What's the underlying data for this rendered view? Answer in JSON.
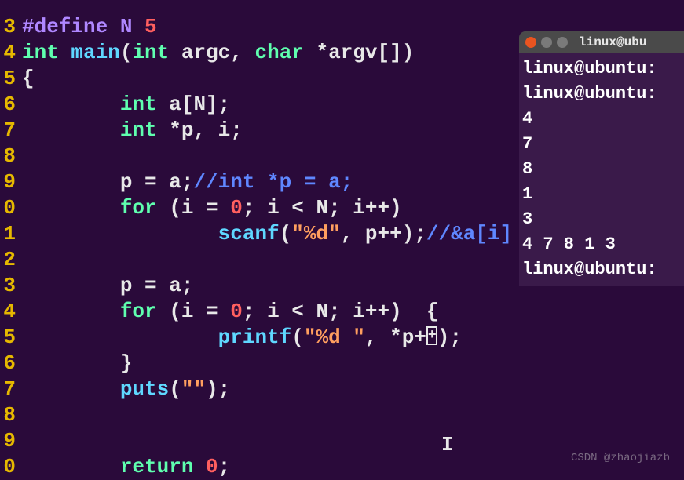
{
  "editor": {
    "lines": [
      {
        "no": "3",
        "segments": [
          {
            "cls": "pre",
            "t": "#define N "
          },
          {
            "cls": "num",
            "t": "5"
          }
        ]
      },
      {
        "no": "4",
        "segments": [
          {
            "cls": "kw",
            "t": "int "
          },
          {
            "cls": "func",
            "t": "main"
          },
          {
            "cls": "op",
            "t": "("
          },
          {
            "cls": "kw",
            "t": "int "
          },
          {
            "cls": "id",
            "t": "argc, "
          },
          {
            "cls": "kw",
            "t": "char "
          },
          {
            "cls": "op",
            "t": "*"
          },
          {
            "cls": "id",
            "t": "argv[])"
          }
        ]
      },
      {
        "no": "5",
        "segments": [
          {
            "cls": "op",
            "t": "{"
          }
        ]
      },
      {
        "no": "6",
        "segments": [
          {
            "cls": "id",
            "t": "        "
          },
          {
            "cls": "kw",
            "t": "int "
          },
          {
            "cls": "id",
            "t": "a[N];"
          }
        ]
      },
      {
        "no": "7",
        "segments": [
          {
            "cls": "id",
            "t": "        "
          },
          {
            "cls": "kw",
            "t": "int "
          },
          {
            "cls": "op",
            "t": "*"
          },
          {
            "cls": "id",
            "t": "p, i;"
          }
        ]
      },
      {
        "no": "8",
        "segments": []
      },
      {
        "no": "9",
        "segments": [
          {
            "cls": "id",
            "t": "        p = a;"
          },
          {
            "cls": "cm",
            "t": "//int *p = a;"
          }
        ]
      },
      {
        "no": "0",
        "segments": [
          {
            "cls": "id",
            "t": "        "
          },
          {
            "cls": "kw",
            "t": "for "
          },
          {
            "cls": "op",
            "t": "(i = "
          },
          {
            "cls": "num",
            "t": "0"
          },
          {
            "cls": "op",
            "t": "; i < N; i++)"
          }
        ]
      },
      {
        "no": "1",
        "segments": [
          {
            "cls": "id",
            "t": "                "
          },
          {
            "cls": "func",
            "t": "scanf"
          },
          {
            "cls": "op",
            "t": "("
          },
          {
            "cls": "str",
            "t": "\"%d\""
          },
          {
            "cls": "op",
            "t": ", p++);"
          },
          {
            "cls": "cm",
            "t": "//&a[i]"
          }
        ]
      },
      {
        "no": "2",
        "segments": []
      },
      {
        "no": "3",
        "segments": [
          {
            "cls": "id",
            "t": "        p = a;"
          }
        ]
      },
      {
        "no": "4",
        "segments": [
          {
            "cls": "id",
            "t": "        "
          },
          {
            "cls": "kw",
            "t": "for "
          },
          {
            "cls": "op",
            "t": "(i = "
          },
          {
            "cls": "num",
            "t": "0"
          },
          {
            "cls": "op",
            "t": "; i < N; i++)  {"
          }
        ]
      },
      {
        "no": "5",
        "segments": [
          {
            "cls": "id",
            "t": "                "
          },
          {
            "cls": "func",
            "t": "printf"
          },
          {
            "cls": "op",
            "t": "("
          },
          {
            "cls": "str",
            "t": "\"%d \""
          },
          {
            "cls": "op",
            "t": ", *p+"
          },
          {
            "cls": "cursor",
            "t": ""
          },
          {
            "cls": "op",
            "t": ");"
          }
        ]
      },
      {
        "no": "6",
        "segments": [
          {
            "cls": "id",
            "t": "        }"
          }
        ]
      },
      {
        "no": "7",
        "segments": [
          {
            "cls": "id",
            "t": "        "
          },
          {
            "cls": "func",
            "t": "puts"
          },
          {
            "cls": "op",
            "t": "("
          },
          {
            "cls": "str",
            "t": "\"\""
          },
          {
            "cls": "op",
            "t": ");"
          }
        ]
      },
      {
        "no": "8",
        "segments": []
      },
      {
        "no": "9",
        "segments": []
      },
      {
        "no": "0",
        "segments": [
          {
            "cls": "id",
            "t": "        "
          },
          {
            "cls": "kw",
            "t": "return "
          },
          {
            "cls": "num",
            "t": "0"
          },
          {
            "cls": "op",
            "t": ";"
          }
        ]
      }
    ]
  },
  "terminal": {
    "title": "linux@ubu",
    "lines": [
      "linux@ubuntu:",
      "linux@ubuntu:",
      "4",
      "7",
      "8",
      "1",
      "3",
      "4 7 8 1 3",
      "linux@ubuntu:"
    ]
  },
  "watermark": "CSDN @zhaojiazb"
}
